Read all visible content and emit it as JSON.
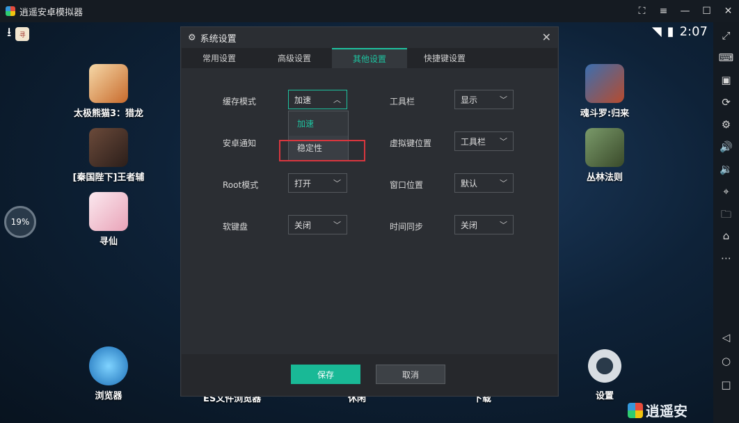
{
  "window": {
    "title": "逍遥安卓模拟器"
  },
  "status": {
    "time": "2:07",
    "progress": "19%"
  },
  "desktop_apps": [
    {
      "label": "太极熊猫3：猎龙"
    },
    {
      "label": "[秦国陛下]王者辅"
    },
    {
      "label": "寻仙"
    },
    {
      "label": "魂斗罗:归来"
    },
    {
      "label": "丛林法则"
    },
    {
      "label": "浏览器"
    },
    {
      "label": "设置"
    }
  ],
  "dock_partial": [
    "ES文件浏览器",
    "休闲",
    "下载"
  ],
  "dialog": {
    "title": "系统设置",
    "tabs": [
      "常用设置",
      "高级设置",
      "其他设置",
      "快捷键设置"
    ],
    "active_tab": "其他设置",
    "settings": {
      "cache_mode": {
        "label": "缓存模式",
        "value": "加速"
      },
      "toolbar": {
        "label": "工具栏",
        "value": "显示"
      },
      "android_notify": {
        "label": "安卓通知",
        "value": ""
      },
      "virtual_key_pos": {
        "label": "虚拟键位置",
        "value": "工具栏"
      },
      "root_mode": {
        "label": "Root模式",
        "value": "打开"
      },
      "window_pos": {
        "label": "窗口位置",
        "value": "默认"
      },
      "soft_keyboard": {
        "label": "软键盘",
        "value": "关闭"
      },
      "time_sync": {
        "label": "时间同步",
        "value": "关闭"
      }
    },
    "dropdown_options": [
      "加速",
      "稳定性"
    ],
    "save": "保存",
    "cancel": "取消"
  },
  "brand": "逍遥安",
  "colors": {
    "accent": "#1ec3a0",
    "highlight": "#d9363e"
  }
}
